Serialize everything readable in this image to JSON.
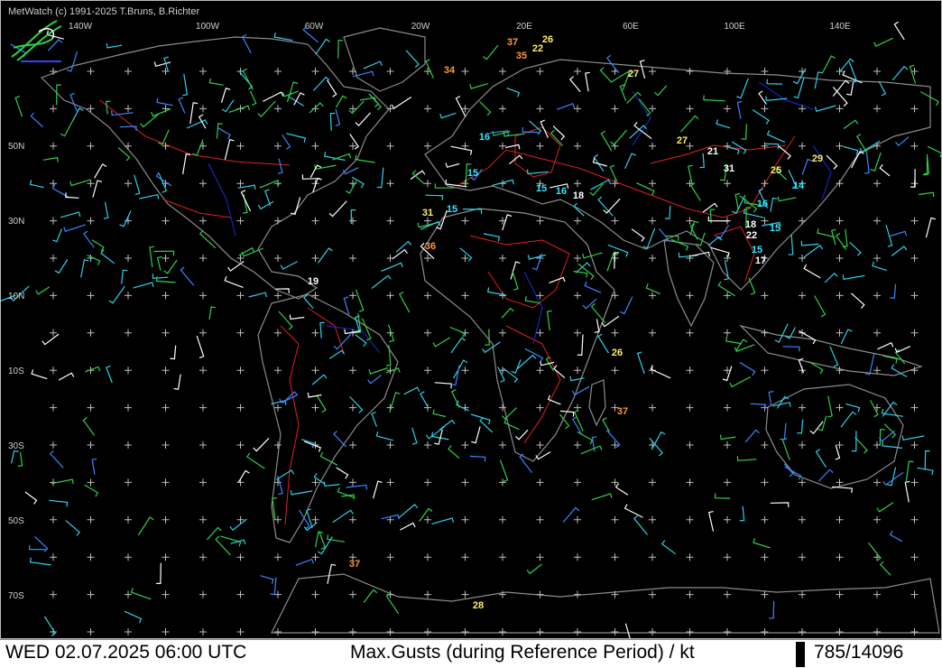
{
  "app": {
    "copyright": "MetWatch  (c) 1991-2025 T.Bruns, B.Richter"
  },
  "status_bar": {
    "datetime": "WED 02.07.2025 06:00 UTC",
    "product": "Max.Gusts (during Reference Period) / kt",
    "counts": "785/14096"
  },
  "axes": {
    "lon_labels": [
      "140W",
      "100W",
      "60W",
      "20W",
      "20E",
      "60E",
      "100E",
      "140E"
    ],
    "lat_labels": [
      "50N",
      "30N",
      "10N",
      "10S",
      "30S",
      "50S",
      "70S"
    ]
  },
  "colors": {
    "background": "#000000",
    "coast": "#8c8c8c",
    "borders": "#e02020",
    "rivers": "#1c2bd6",
    "wind_cyan": "#2fd0e8",
    "wind_green": "#2fd04a",
    "wind_blue": "#3a86ff",
    "wind_white": "#ffffff",
    "gust_yellow": "#ffee66",
    "gust_orange": "#ff9a30",
    "gust_cyan": "#33e6ff",
    "gust_white": "#ffffff",
    "grid": "#bdbdbd"
  },
  "gusts": [
    {
      "value": "37",
      "color": "orange"
    },
    {
      "value": "22",
      "color": "yellow"
    },
    {
      "value": "26",
      "color": "yellow"
    },
    {
      "value": "35",
      "color": "orange"
    },
    {
      "value": "34",
      "color": "orange"
    },
    {
      "value": "27",
      "color": "yellow"
    },
    {
      "value": "16",
      "color": "cyan"
    },
    {
      "value": "27",
      "color": "yellow"
    },
    {
      "value": "21",
      "color": "white"
    },
    {
      "value": "31",
      "color": "white"
    },
    {
      "value": "25",
      "color": "yellow"
    },
    {
      "value": "29",
      "color": "yellow"
    },
    {
      "value": "15",
      "color": "cyan"
    },
    {
      "value": "15",
      "color": "cyan"
    },
    {
      "value": "16",
      "color": "cyan"
    },
    {
      "value": "18",
      "color": "white"
    },
    {
      "value": "14",
      "color": "cyan"
    },
    {
      "value": "16",
      "color": "cyan"
    },
    {
      "value": "31",
      "color": "yellow"
    },
    {
      "value": "15",
      "color": "cyan"
    },
    {
      "value": "18",
      "color": "white"
    },
    {
      "value": "22",
      "color": "white"
    },
    {
      "value": "15",
      "color": "cyan"
    },
    {
      "value": "36",
      "color": "orange"
    },
    {
      "value": "15",
      "color": "cyan"
    },
    {
      "value": "17",
      "color": "white"
    },
    {
      "value": "19",
      "color": "white"
    },
    {
      "value": "26",
      "color": "yellow"
    },
    {
      "value": "37",
      "color": "orange"
    },
    {
      "value": "37",
      "color": "orange"
    },
    {
      "value": "28",
      "color": "yellow"
    }
  ],
  "icons": {
    "logo": "metwatch-logo-icon"
  }
}
